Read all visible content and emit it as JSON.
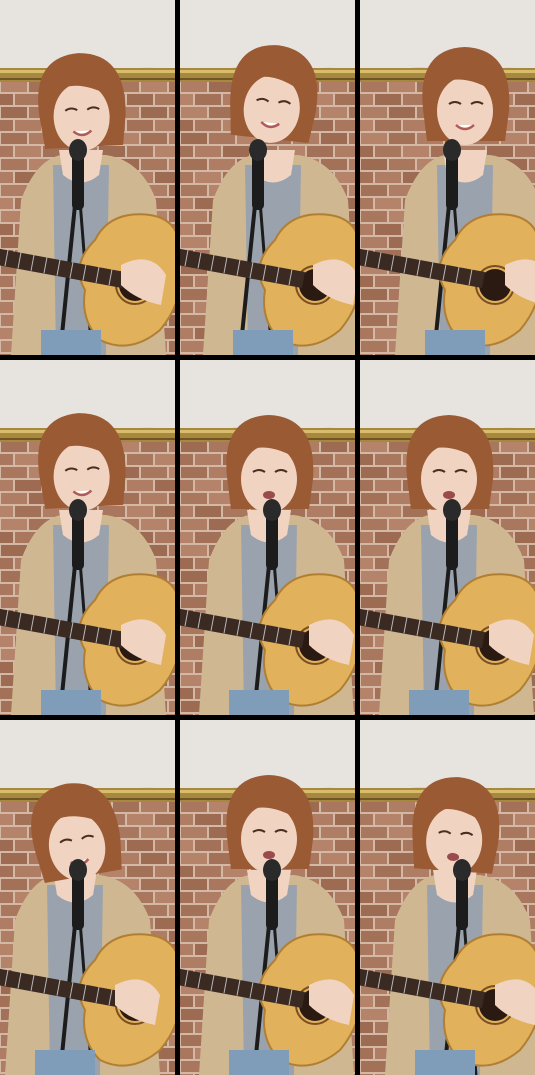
{
  "grid": {
    "rows": 3,
    "columns": 3,
    "frames": [
      {
        "pose": "smile-left",
        "mic": "center-left",
        "guitar_head": "left"
      },
      {
        "pose": "smile-right",
        "mic": "center-left",
        "guitar_head": "left"
      },
      {
        "pose": "smile-center",
        "mic": "center",
        "guitar_head": "left"
      },
      {
        "pose": "smile-left",
        "mic": "center-left",
        "guitar_head": "left"
      },
      {
        "pose": "sing-center",
        "mic": "center",
        "guitar_head": "left"
      },
      {
        "pose": "sing-center",
        "mic": "center",
        "guitar_head": "left"
      },
      {
        "pose": "tilt-left",
        "mic": "center-left",
        "guitar_head": "left"
      },
      {
        "pose": "sing-center",
        "mic": "center",
        "guitar_head": "left"
      },
      {
        "pose": "sing-right",
        "mic": "center-right",
        "guitar_head": "left"
      }
    ]
  },
  "colors": {
    "separator": "#000000",
    "brick": "#b5826a",
    "mortar": "#d4b8a6",
    "plaster": "#e7e4df",
    "frame_gold": "#a8873e",
    "hair": "#9a5a33",
    "skin": "#f1d3c2",
    "cardigan": "#cfb891",
    "top": "#9aa3ad",
    "jeans": "#7f9db8",
    "guitar_body": "#e2b15c",
    "guitar_neck": "#3b2a22",
    "mic": "#1c1c1c"
  }
}
